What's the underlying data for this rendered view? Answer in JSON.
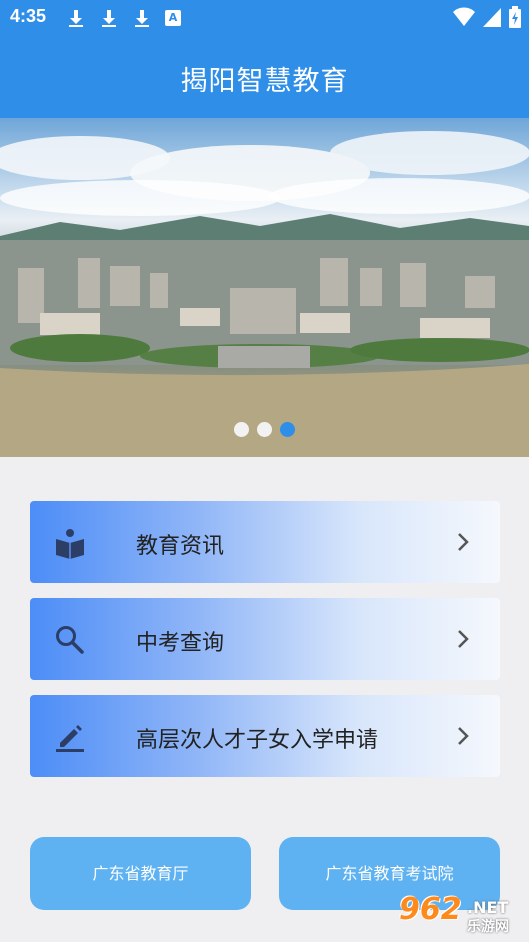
{
  "status_bar": {
    "time": "4:35",
    "left_icons": [
      "download-icon",
      "download-icon",
      "download-icon",
      "a-notification-icon"
    ],
    "right_icons": [
      "wifi-icon",
      "signal-icon",
      "battery-icon"
    ],
    "a_glyph": "A"
  },
  "app_bar": {
    "title": "揭阳智慧教育",
    "color": "#2e8ee8"
  },
  "banner": {
    "slides": 3,
    "active_slide": 3
  },
  "menu": [
    {
      "icon": "book-reader-icon",
      "label": "教育资讯"
    },
    {
      "icon": "search-icon",
      "label": "中考查询"
    },
    {
      "icon": "edit-pen-icon",
      "label": "高层次人才子女入学申请"
    }
  ],
  "bottom_buttons": [
    {
      "label": "广东省教育厅"
    },
    {
      "label": "广东省教育考试院"
    }
  ],
  "watermark": {
    "logo": "962",
    "net": ".NET",
    "sub": "乐游网"
  }
}
